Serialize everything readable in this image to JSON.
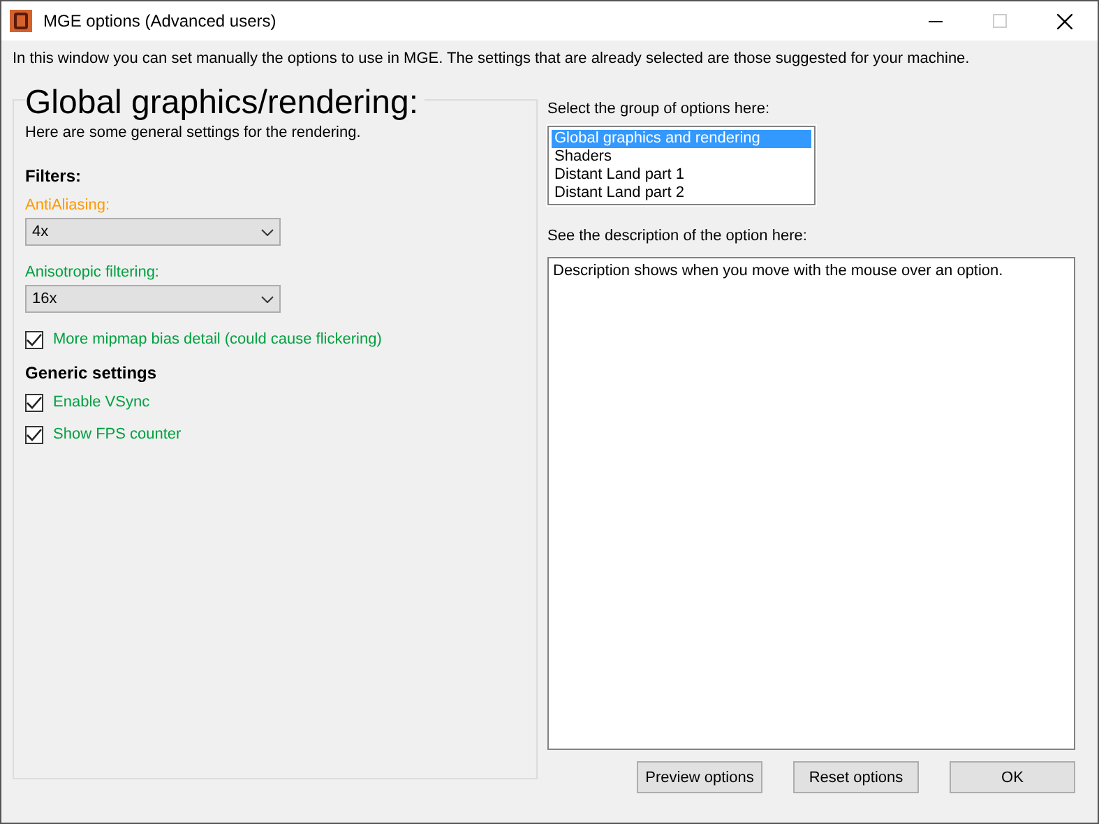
{
  "window": {
    "title": "MGE options (Advanced users)"
  },
  "intro": "In this window you can set manually the options to use in MGE. The settings that are already selected are those suggested for your machine.",
  "panel": {
    "title": "Global graphics/rendering:",
    "subtitle": "Here are some general settings for the rendering.",
    "items": [
      {
        "kind": "heading",
        "text": "Filters:"
      },
      {
        "kind": "dropdown",
        "label": "AntiAliasing:",
        "color": "#ff9900",
        "value": "4x"
      },
      {
        "kind": "dropdown",
        "label": "Anisotropic filtering:",
        "color": "#00a040",
        "value": "16x"
      },
      {
        "kind": "checkbox",
        "label": "More mipmap bias detail (could cause flickering)",
        "color": "#00a040",
        "checked": true
      },
      {
        "kind": "heading",
        "text": "Generic settings"
      },
      {
        "kind": "checkbox",
        "label": "Enable VSync",
        "color": "#00a040",
        "checked": true
      },
      {
        "kind": "checkbox",
        "label": "Show FPS counter",
        "color": "#00a040",
        "checked": true
      }
    ]
  },
  "groups": {
    "label": "Select the group of options here:",
    "items": [
      {
        "text": "Global graphics and rendering",
        "selected": true
      },
      {
        "text": "Shaders",
        "selected": false
      },
      {
        "text": "Distant Land part 1",
        "selected": false
      },
      {
        "text": "Distant Land part 2",
        "selected": false
      }
    ]
  },
  "description": {
    "label": "See the description of the option here:",
    "text": "Description shows when you move with the mouse over an option."
  },
  "buttons": [
    "Preview options",
    "Reset options",
    "OK"
  ]
}
